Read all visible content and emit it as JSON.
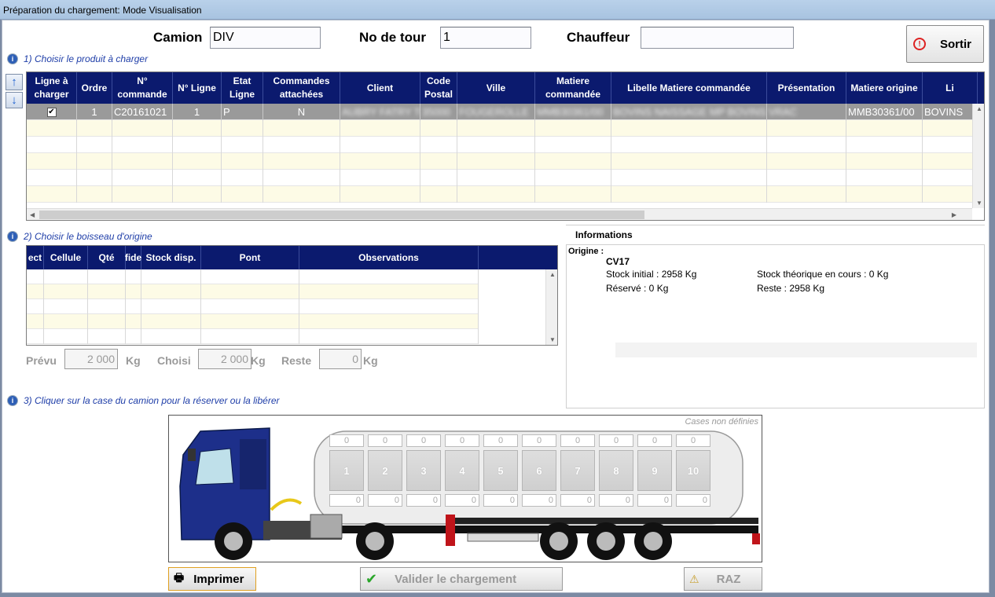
{
  "window": {
    "title": "Préparation du chargement: Mode Visualisation"
  },
  "header": {
    "camion_label": "Camion",
    "camion_value": "DIV",
    "tour_label": "No de tour",
    "tour_value": "1",
    "chauffeur_label": "Chauffeur",
    "chauffeur_value": "",
    "sortir_label": "Sortir"
  },
  "step1": {
    "label": "1) Choisir le produit à charger"
  },
  "grid1": {
    "headers": [
      "Ligne à charger",
      "Ordre",
      "N° commande",
      "N° Ligne",
      "Etat Ligne",
      "Commandes attachées",
      "Client",
      "Code Postal",
      "Ville",
      "Matiere commandée",
      "Libelle Matiere commandée",
      "Présentation",
      "Matiere origine",
      "Li"
    ],
    "row": {
      "ordre": "1",
      "commande": "C20161021",
      "ligne": "1",
      "etat": "P",
      "attachees": "N",
      "client": "AUBRY FATRY TOUTOU",
      "code_postal": "35000",
      "ville": "FOUGEROLLE",
      "matiere": "MMB30361/00",
      "libelle": "BOVINS NAISSAGE MP BOVINS",
      "presentation": "VRAC",
      "origine": "MMB30361/00",
      "li": "BOVINS"
    }
  },
  "step2": {
    "label": "2) Choisir le boisseau d'origine"
  },
  "grid2": {
    "headers": [
      "ect",
      "Cellule",
      "Qté",
      "fide",
      "Stock disp.",
      "Pont",
      "Observations"
    ]
  },
  "quantities": {
    "prevu_label": "Prévu",
    "prevu_value": "2 000",
    "prevu_unit": "Kg",
    "choisi_label": "Choisi",
    "choisi_value": "2 000",
    "choisi_unit": "Kg",
    "reste_label": "Reste",
    "reste_value": "0",
    "reste_unit": "Kg"
  },
  "informations": {
    "title": "Informations",
    "origine": "Origine :",
    "cell": "CV17",
    "stock_initial": "Stock initial : 2958 Kg",
    "reserve": "Réservé : 0 Kg",
    "stock_theorique": "Stock théorique en cours : 0 Kg",
    "reste": "Reste : 2958 Kg"
  },
  "step3": {
    "label": "3) Cliquer sur la case du camion pour la réserver ou la libérer"
  },
  "truck": {
    "undefined_label": "Cases non définies",
    "compartments": [
      {
        "num": "1",
        "top": "0",
        "bottom": "0"
      },
      {
        "num": "2",
        "top": "0",
        "bottom": "0"
      },
      {
        "num": "3",
        "top": "0",
        "bottom": "0"
      },
      {
        "num": "4",
        "top": "0",
        "bottom": "0"
      },
      {
        "num": "5",
        "top": "0",
        "bottom": "0"
      },
      {
        "num": "6",
        "top": "0",
        "bottom": "0"
      },
      {
        "num": "7",
        "top": "0",
        "bottom": "0"
      },
      {
        "num": "8",
        "top": "0",
        "bottom": "0"
      },
      {
        "num": "9",
        "top": "0",
        "bottom": "0"
      },
      {
        "num": "10",
        "top": "0",
        "bottom": "0"
      }
    ]
  },
  "actions": {
    "print_label": "Imprimer",
    "validate_label": "Valider le chargement",
    "raz_label": "RAZ"
  },
  "colors": {
    "grid_header": "#0b1a6e",
    "row_alt": "#fdfbe6",
    "row_selected": "#9a9a9a",
    "step_text": "#1f3ea8",
    "truck_cab": "#1d2f8a"
  },
  "icons": [
    "exit-icon",
    "info-icon",
    "arrow-up-icon",
    "arrow-down-icon",
    "printer-icon",
    "checkmark-icon",
    "warning-icon",
    "column-search-icon"
  ]
}
